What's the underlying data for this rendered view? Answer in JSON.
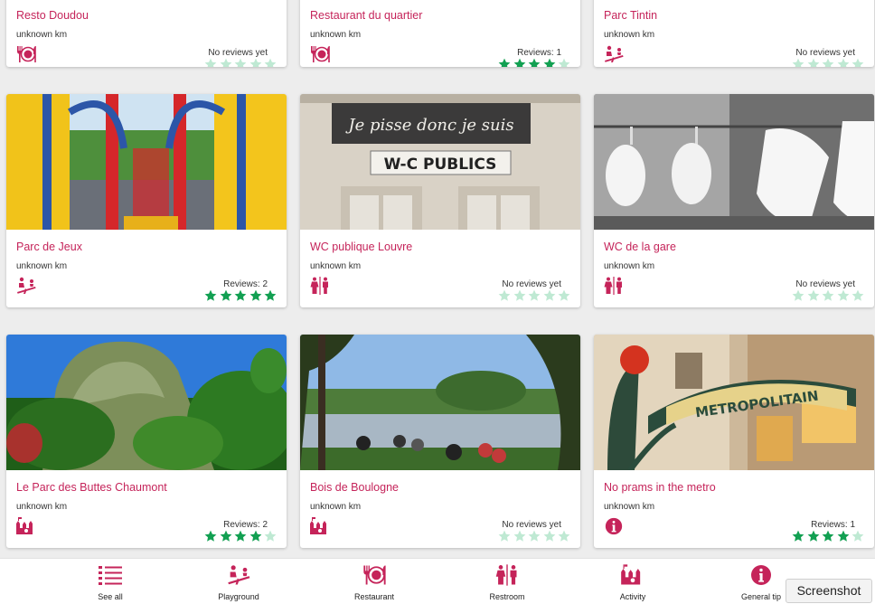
{
  "cards": [
    {
      "title": "Resto Doudou",
      "distance": "unknown km",
      "reviews": "No reviews yet",
      "rating": 0,
      "icon": "restaurant-icon",
      "image": null
    },
    {
      "title": "Restaurant du quartier",
      "distance": "unknown km",
      "reviews": "Reviews: 1",
      "rating": 4,
      "icon": "restaurant-icon",
      "image": null
    },
    {
      "title": "Parc Tintin",
      "distance": "unknown km",
      "reviews": "No reviews yet",
      "rating": 0,
      "icon": "playground-icon",
      "image": null
    },
    {
      "title": "Parc de Jeux",
      "distance": "unknown km",
      "reviews": "Reviews: 2",
      "rating": 5,
      "icon": "playground-icon",
      "image": "playground"
    },
    {
      "title": "WC publique Louvre",
      "distance": "unknown km",
      "reviews": "No reviews yet",
      "rating": 0,
      "icon": "restroom-icon",
      "image": "wc-sign",
      "image_text": {
        "line1": "Je pisse donc je suis",
        "line2": "W-C PUBLICS"
      }
    },
    {
      "title": "WC de la gare",
      "distance": "unknown km",
      "reviews": "No reviews yet",
      "rating": 0,
      "icon": "restroom-icon",
      "image": "urinals"
    },
    {
      "title": "Le Parc des Buttes Chaumont",
      "distance": "unknown km",
      "reviews": "Reviews: 2",
      "rating": 4,
      "icon": "activity-icon",
      "image": "buttes"
    },
    {
      "title": "Bois de Boulogne",
      "distance": "unknown km",
      "reviews": "No reviews yet",
      "rating": 0,
      "icon": "activity-icon",
      "image": "lake"
    },
    {
      "title": "No prams in the metro",
      "distance": "unknown km",
      "reviews": "Reviews: 1",
      "rating": 4,
      "icon": "info-icon",
      "image": "metro",
      "image_text": {
        "line1": "METROPOLITAIN"
      }
    }
  ],
  "nav": [
    {
      "label": "See all",
      "icon": "list-icon"
    },
    {
      "label": "Playground",
      "icon": "playground-icon"
    },
    {
      "label": "Restaurant",
      "icon": "restaurant-icon"
    },
    {
      "label": "Restroom",
      "icon": "restroom-icon"
    },
    {
      "label": "Activity",
      "icon": "activity-icon"
    },
    {
      "label": "General tip",
      "icon": "info-icon"
    }
  ],
  "screenshot_button": "Screenshot",
  "colors": {
    "accent": "#c5245a",
    "star_on": "#12a052",
    "star_off": "#bfe9d3"
  }
}
